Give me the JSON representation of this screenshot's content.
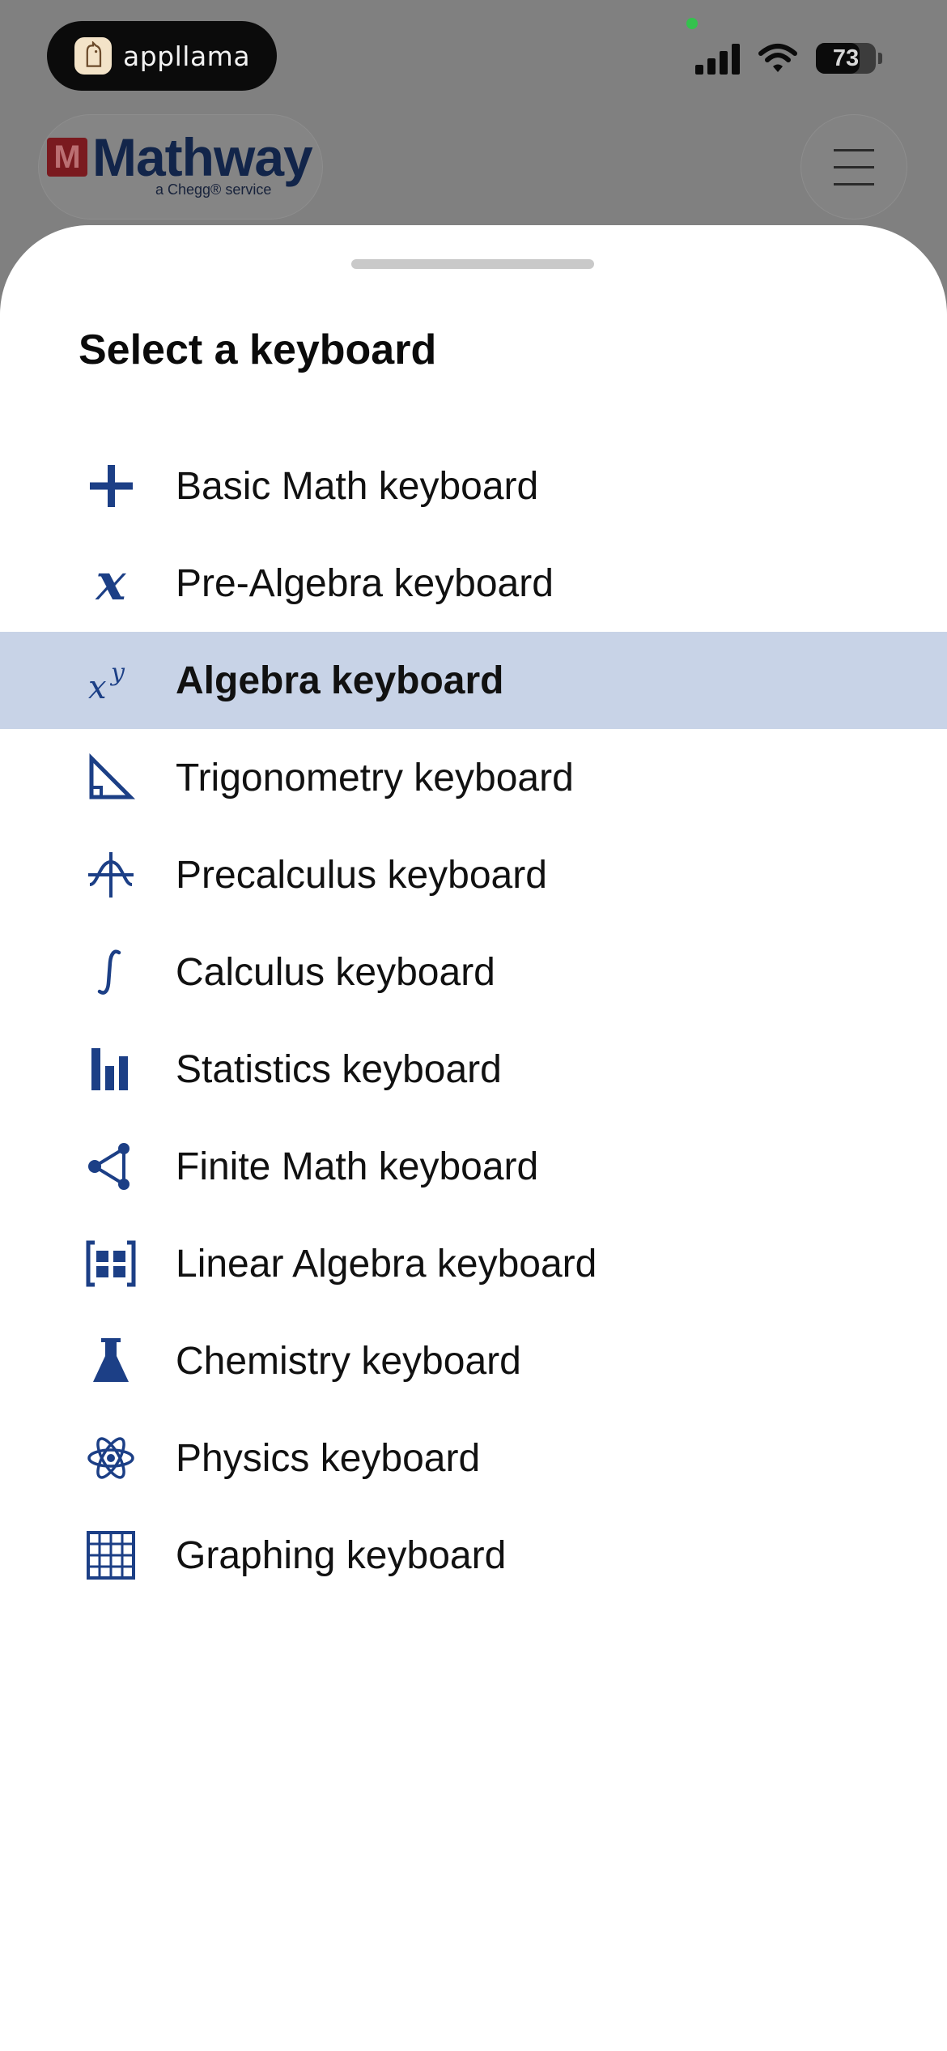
{
  "status_bar": {
    "app_name": "appllama",
    "battery_percent": "73",
    "battery_level": 0.73
  },
  "header": {
    "logo_text": "Mathway",
    "logo_mark": "M",
    "logo_subtext": "a Chegg® service"
  },
  "sheet": {
    "title": "Select a keyboard",
    "items": [
      {
        "label": "Basic Math keyboard",
        "icon": "plus-icon",
        "selected": false
      },
      {
        "label": "Pre-Algebra keyboard",
        "icon": "variable-x-icon",
        "selected": false
      },
      {
        "label": "Algebra keyboard",
        "icon": "x-power-y-icon",
        "selected": true
      },
      {
        "label": "Trigonometry keyboard",
        "icon": "triangle-ruler-icon",
        "selected": false
      },
      {
        "label": "Precalculus keyboard",
        "icon": "function-graph-icon",
        "selected": false
      },
      {
        "label": "Calculus keyboard",
        "icon": "integral-icon",
        "selected": false
      },
      {
        "label": "Statistics keyboard",
        "icon": "bar-chart-icon",
        "selected": false
      },
      {
        "label": "Finite Math keyboard",
        "icon": "share-nodes-icon",
        "selected": false
      },
      {
        "label": "Linear Algebra keyboard",
        "icon": "matrix-icon",
        "selected": false
      },
      {
        "label": "Chemistry keyboard",
        "icon": "flask-icon",
        "selected": false
      },
      {
        "label": "Physics keyboard",
        "icon": "atom-icon",
        "selected": false
      },
      {
        "label": "Graphing keyboard",
        "icon": "grid-icon",
        "selected": false
      }
    ]
  },
  "colors": {
    "accent": "#1c3f86",
    "selected_row": "#c8d3e7",
    "overlay": "#808080"
  }
}
